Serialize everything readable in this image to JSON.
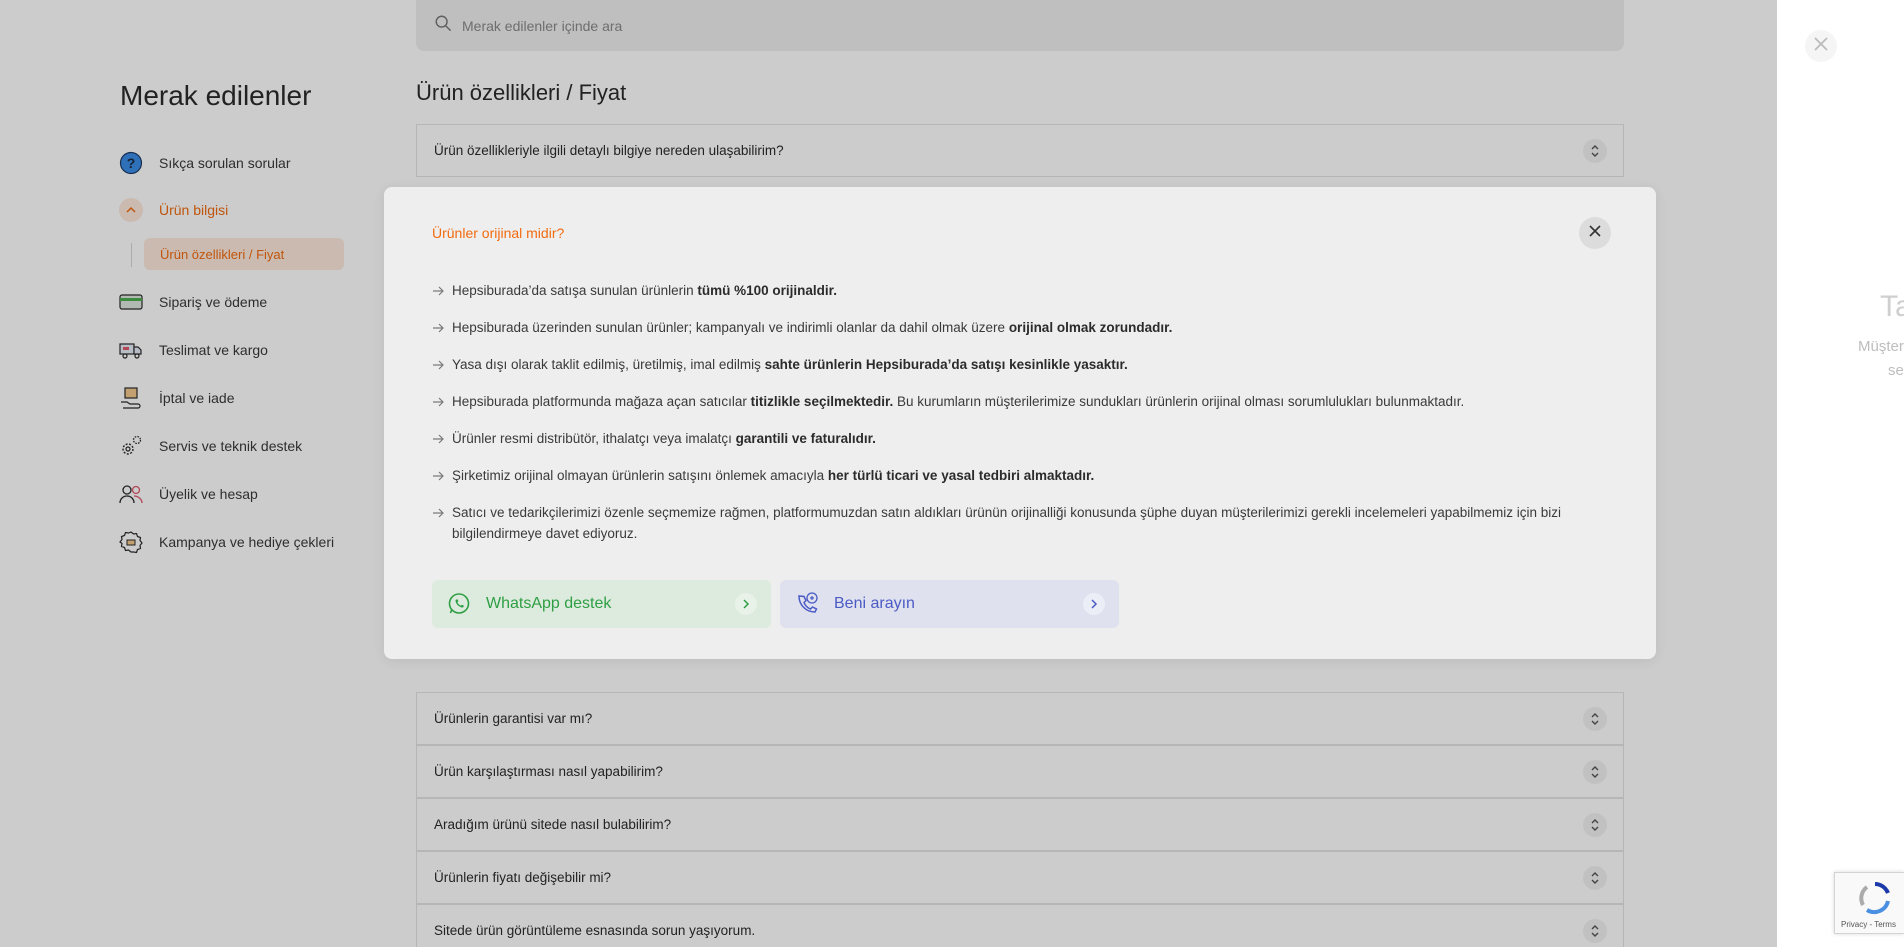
{
  "search": {
    "placeholder": "Merak edilenler içinde ara"
  },
  "sidebar": {
    "title": "Merak edilenler",
    "items": [
      {
        "label": "Sıkça sorulan sorular",
        "icon": "question-icon"
      },
      {
        "label": "Ürün bilgisi",
        "icon": "chevron-up-icon",
        "active": true
      },
      {
        "label": "Sipariş ve ödeme",
        "icon": "card-icon"
      },
      {
        "label": "Teslimat ve kargo",
        "icon": "truck-icon"
      },
      {
        "label": "İptal ve iade",
        "icon": "return-box-icon"
      },
      {
        "label": "Servis ve teknik destek",
        "icon": "gears-icon"
      },
      {
        "label": "Üyelik ve hesap",
        "icon": "users-icon"
      },
      {
        "label": "Kampanya ve hediye çekleri",
        "icon": "gift-voucher-icon"
      }
    ],
    "sub_item": "Ürün özellikleri / Fiyat"
  },
  "main": {
    "title": "Ürün özellikleri / Fiyat",
    "faq_top": "Ürün özellikleriyle ilgili detaylı bilgiye nereden ulaşabilirim?",
    "expanded": {
      "question": "Ürünler orijinal midir?",
      "answers": [
        {
          "pre": "Hepsiburada’da satışa sunulan ürünlerin ",
          "bold": "tümü %100 orijinaldir.",
          "post": ""
        },
        {
          "pre": "Hepsiburada üzerinden sunulan ürünler; kampanyalı ve indirimli olanlar da dahil olmak üzere ",
          "bold": "orijinal olmak zorundadır.",
          "post": ""
        },
        {
          "pre": "Yasa dışı olarak taklit edilmiş, üretilmiş, imal edilmiş ",
          "bold": "sahte ürünlerin Hepsiburada’da satışı kesinlikle yasaktır.",
          "post": ""
        },
        {
          "pre": "Hepsiburada platformunda mağaza açan satıcılar ",
          "bold": "titizlikle seçilmektedir.",
          "post": " Bu kurumların müşterilerimize sundukları ürünlerin orijinal olması sorumlulukları bulunmaktadır."
        },
        {
          "pre": "Ürünler resmi distribütör, ithalatçı veya imalatçı ",
          "bold": "garantili ve faturalıdır.",
          "post": ""
        },
        {
          "pre": "Şirketimiz orijinal olmayan ürünlerin satışını önlemek amacıyla ",
          "bold": "her türlü ticari ve yasal tedbiri almaktadır.",
          "post": ""
        },
        {
          "pre": "Satıcı ve tedarikçilerimizi özenle seçmemize rağmen, platformumuzdan satın aldıkları ürünün orijinalliği konusunda şüphe duyan müşterilerimizi gerekli incelemeleri yapabilmemiz için bizi bilgilendirmeye davet ediyoruz.",
          "bold": "",
          "post": ""
        }
      ],
      "whatsapp_label": "WhatsApp destek",
      "call_label": "Beni arayın"
    },
    "faqs": [
      "Ürünlerin garantisi var mı?",
      "Ürün karşılaştırması nasıl yapabilirim?",
      "Aradığım ürünü sitede nasıl bulabilirim?",
      "Ürünlerin fiyatı değişebilir mi?",
      "Sitede ürün görüntüleme esnasında sorun yaşıyorum."
    ]
  },
  "right_panel": {
    "title_fragment": "Ta",
    "line1": "Müşter",
    "line2": "se"
  },
  "recaptcha": {
    "text": "Privacy - Terms"
  },
  "colors": {
    "accent": "#f26b0f",
    "whatsapp": "#2f9e44",
    "call": "#4b5bc4"
  }
}
